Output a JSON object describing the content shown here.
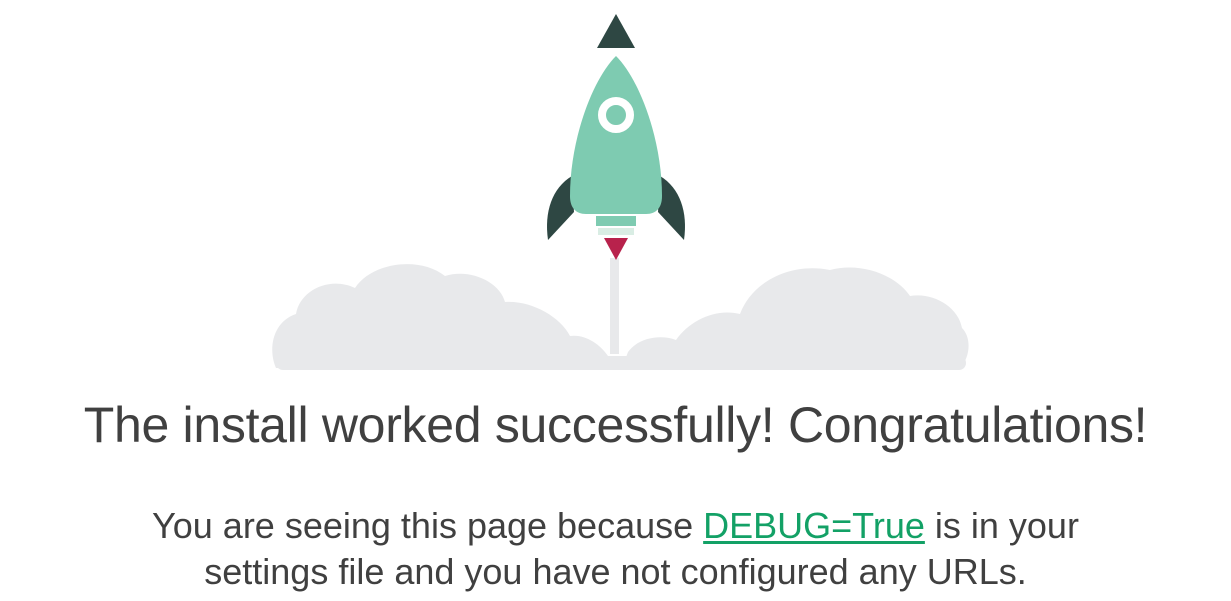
{
  "headline": "The install worked successfully! Congratulations!",
  "message": {
    "before_link": "You are seeing this page because ",
    "link_text": "DEBUG=True",
    "after_link": " is in your",
    "second_line": "settings file and you have not configured any URLs."
  },
  "colors": {
    "rocket_body": "#7ecbb1",
    "rocket_fins": "#2e4743",
    "flame": "#b8224c",
    "clouds": "#e8e9eb",
    "link": "#13a166",
    "text": "#404040"
  },
  "icons": {
    "illustration": "rocket-launch-illustration"
  }
}
